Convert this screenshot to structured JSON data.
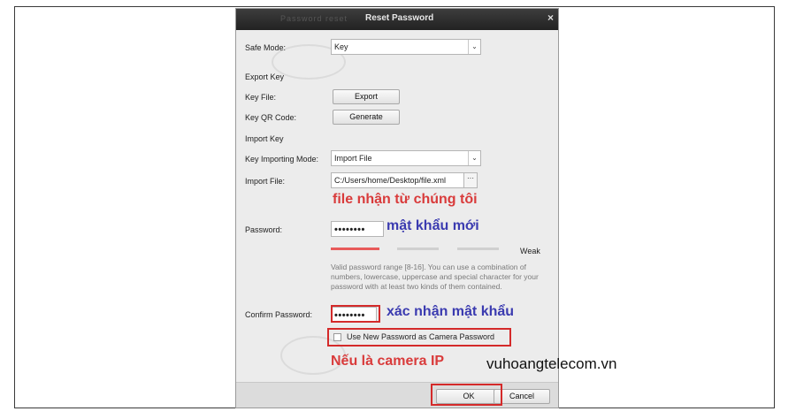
{
  "dialog": {
    "title": "Reset Password",
    "ghost_title": "Password reset",
    "close_glyph": "×"
  },
  "form": {
    "safe_mode_label": "Safe Mode:",
    "safe_mode_value": "Key",
    "export_key_heading": "Export Key",
    "key_file_label": "Key File:",
    "export_button": "Export",
    "key_qr_label": "Key QR Code:",
    "generate_button": "Generate",
    "import_key_heading": "Import Key",
    "key_importing_mode_label": "Key Importing Mode:",
    "key_importing_mode_value": "Import File",
    "import_file_label": "Import File:",
    "import_file_value": "C:/Users/home/Desktop/file.xml",
    "browse_glyph": "···",
    "password_label": "Password:",
    "password_value": "••••••••",
    "strength_label": "Weak",
    "strength_level": 0.25,
    "hint": "Valid password range [8-16]. You can use a combination of numbers, lowercase, uppercase and special character for your password with at least two kinds of them contained.",
    "confirm_password_label": "Confirm Password:",
    "confirm_password_value": "••••••••",
    "use_camera_password_label": "Use New Password as Camera Password",
    "use_camera_password_checked": false,
    "dropdown_arrow": "⌄"
  },
  "footer": {
    "ok_button": "OK",
    "cancel_button": "Cancel"
  },
  "annotations": {
    "file_note": "file nhận từ chúng tôi",
    "new_password_note": "mật khẩu mới",
    "confirm_note": "xác nhận mật khẩu",
    "camera_note": "Nếu là camera IP",
    "red_color": "#d93b3b",
    "blue_color": "#3b3bb0"
  },
  "watermark": "vuhoangtelecom.vn"
}
